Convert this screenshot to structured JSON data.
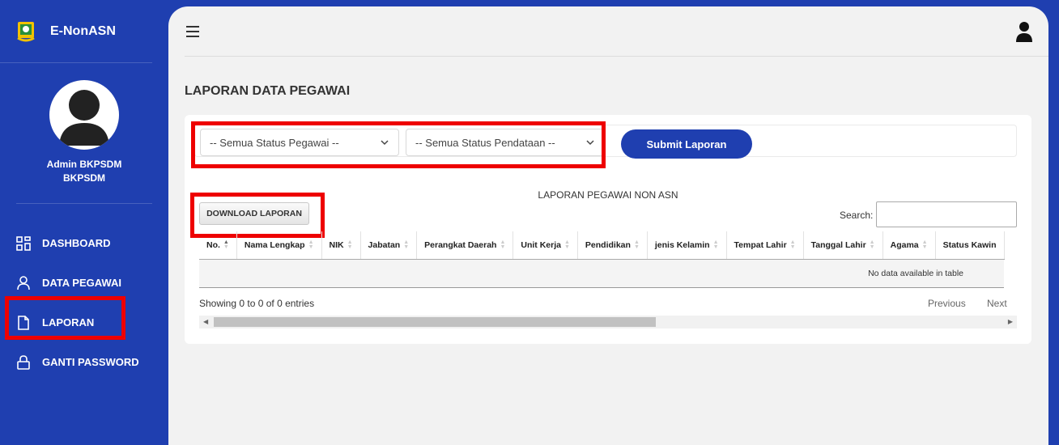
{
  "sidebar": {
    "brand": "E-NonASN",
    "profile_name": "Admin BKPSDM",
    "profile_unit": "BKPSDM",
    "items": [
      {
        "label": "DASHBOARD",
        "icon": "grid-icon"
      },
      {
        "label": "DATA PEGAWAI",
        "icon": "user-icon"
      },
      {
        "label": "LAPORAN",
        "icon": "file-icon"
      },
      {
        "label": "GANTI PASSWORD",
        "icon": "lock-icon"
      }
    ]
  },
  "main": {
    "page_title": "LAPORAN DATA PEGAWAI",
    "filters": {
      "status_pegawai": "-- Semua Status Pegawai --",
      "status_pendataan": "-- Semua Status Pendataan --",
      "submit_label": "Submit Laporan"
    },
    "report_title": "LAPORAN PEGAWAI NON ASN",
    "download_label": "DOWNLOAD LAPORAN",
    "search_label": "Search:",
    "columns": [
      "No.",
      "Nama Lengkap",
      "NIK",
      "Jabatan",
      "Perangkat Daerah",
      "Unit Kerja",
      "Pendidikan",
      "jenis Kelamin",
      "Tempat Lahir",
      "Tanggal Lahir",
      "Agama",
      "Status Kawin"
    ],
    "empty_message": "No data available in table",
    "info": "Showing 0 to 0 of 0 entries",
    "previous": "Previous",
    "next": "Next"
  },
  "colors": {
    "brand_blue": "#1f3fb0",
    "highlight_red": "#ee0000"
  }
}
